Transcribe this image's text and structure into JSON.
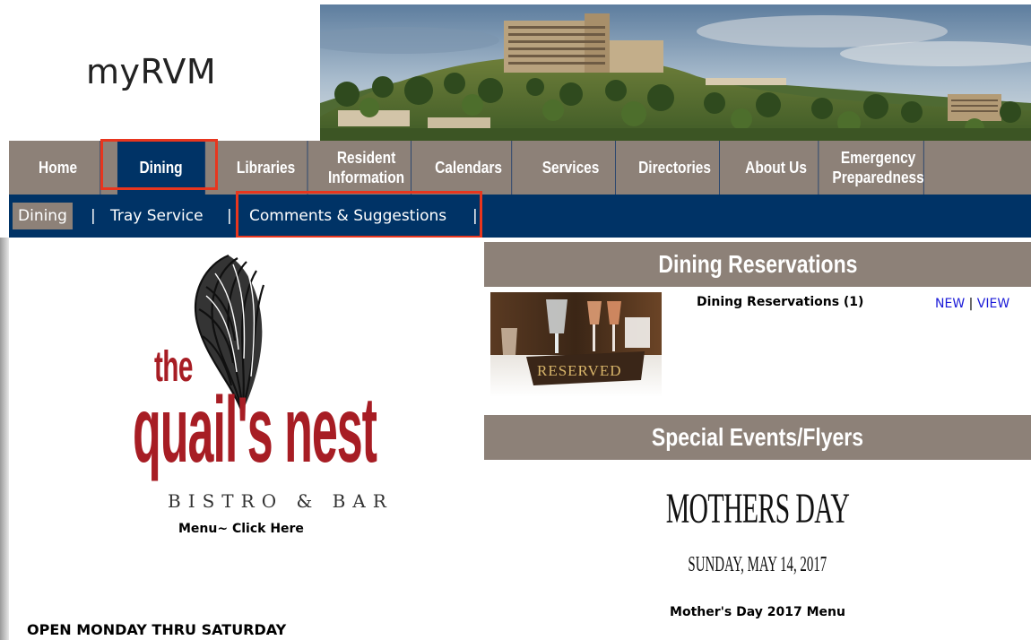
{
  "header": {
    "logo_text": "myRVM"
  },
  "main_nav": {
    "items": [
      {
        "label_line1": "Home",
        "label_line2": ""
      },
      {
        "label_line1": "Dining",
        "label_line2": ""
      },
      {
        "label_line1": "Libraries",
        "label_line2": ""
      },
      {
        "label_line1": "Resident",
        "label_line2": "Information"
      },
      {
        "label_line1": "Calendars",
        "label_line2": ""
      },
      {
        "label_line1": "Services",
        "label_line2": ""
      },
      {
        "label_line1": "Directories",
        "label_line2": ""
      },
      {
        "label_line1": "About Us",
        "label_line2": ""
      },
      {
        "label_line1": "Emergency",
        "label_line2": "Preparedness"
      }
    ],
    "active": "Dining"
  },
  "sub_nav": {
    "items": [
      "Dining",
      "Tray Service",
      "Comments & Suggestions"
    ],
    "separator": "|",
    "active": "Dining"
  },
  "left": {
    "logo_the": "the",
    "logo_name": "quail's nest",
    "logo_sub": "BISTRO & BAR",
    "menu_link": "Menu~ Click Here",
    "hours_text": "OPEN MONDAY THRU SATURDAY"
  },
  "reservations": {
    "header": "Dining Reservations",
    "title": "Dining Reservations (1)",
    "new_label": "NEW",
    "separator": "|",
    "view_label": "VIEW",
    "photo_sign": "RESERVED"
  },
  "events": {
    "header": "Special Events/Flyers",
    "flyer_title": "MOTHERS DAY",
    "flyer_date": "SUNDAY, MAY 14, 2017",
    "flyer_menu": "Mother's Day 2017 Menu"
  },
  "colors": {
    "nav_bg": "#8d8178",
    "nav_active": "#003366",
    "subnav_bg": "#003366",
    "brand_red": "#a71d24",
    "highlight_box": "#e8361e",
    "link_blue": "#1a1ad8"
  }
}
